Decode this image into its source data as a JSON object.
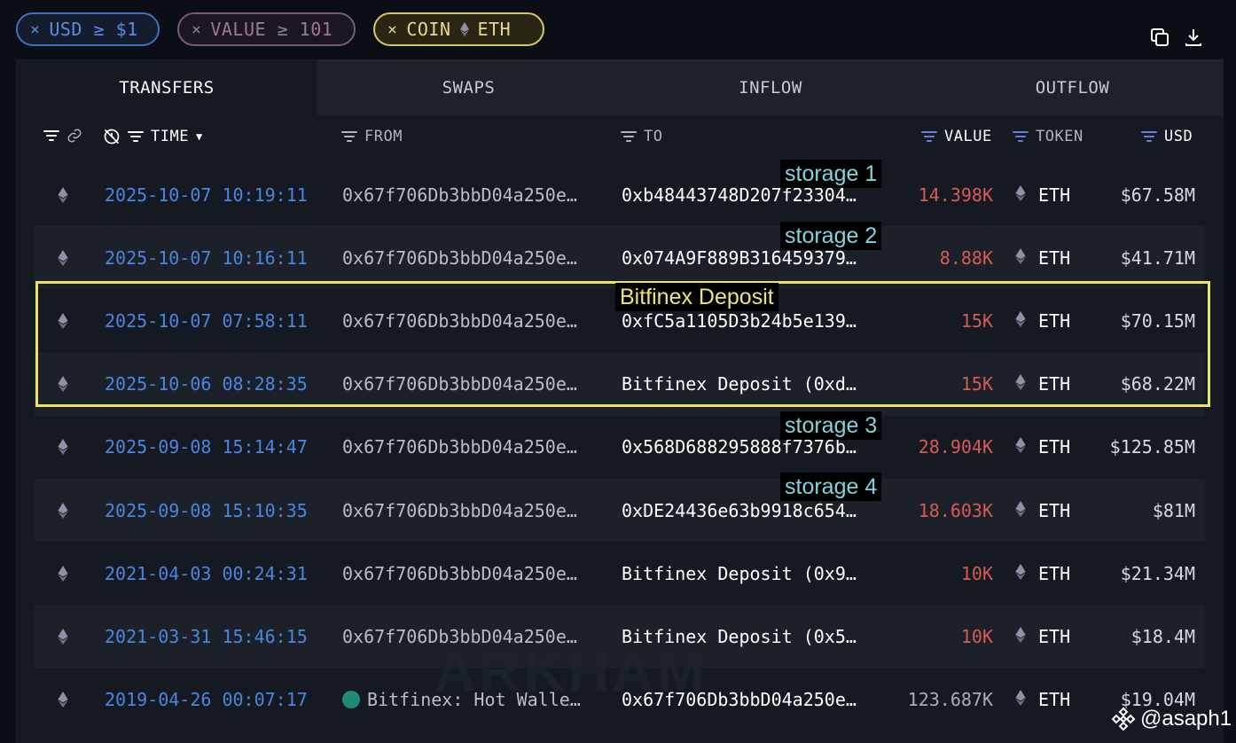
{
  "filters": {
    "usd_chip": "USD ≥ $1",
    "value_chip": "VALUE ≥ 101",
    "coin_chip_prefix": "COIN",
    "coin_chip_value": "ETH",
    "remove_symbol": "×"
  },
  "tabs": [
    "TRANSFERS",
    "SWAPS",
    "INFLOW",
    "OUTFLOW"
  ],
  "columns": {
    "time": "TIME",
    "from": "FROM",
    "to": "TO",
    "value": "VALUE",
    "token": "TOKEN",
    "usd": "USD"
  },
  "rows": [
    {
      "time": "2025-10-07 10:19:11",
      "from": "0x67f706Db3bbD04a250e…",
      "to": "0xb48443748D207f23304…",
      "value": "14.398K",
      "token": "ETH",
      "usd": "$67.58M"
    },
    {
      "time": "2025-10-07 10:16:11",
      "from": "0x67f706Db3bbD04a250e…",
      "to": "0x074A9F889B316459379…",
      "value": "8.88K",
      "token": "ETH",
      "usd": "$41.71M"
    },
    {
      "time": "2025-10-07 07:58:11",
      "from": "0x67f706Db3bbD04a250e…",
      "to": "0xfC5a1105D3b24b5e139…",
      "value": "15K",
      "token": "ETH",
      "usd": "$70.15M"
    },
    {
      "time": "2025-10-06 08:28:35",
      "from": "0x67f706Db3bbD04a250e…",
      "to": "Bitfinex Deposit (0xd…",
      "value": "15K",
      "token": "ETH",
      "usd": "$68.22M"
    },
    {
      "time": "2025-09-08 15:14:47",
      "from": "0x67f706Db3bbD04a250e…",
      "to": "0x568D688295888f7376b…",
      "value": "28.904K",
      "token": "ETH",
      "usd": "$125.85M"
    },
    {
      "time": "2025-09-08 15:10:35",
      "from": "0x67f706Db3bbD04a250e…",
      "to": "0xDE24436e63b9918c654…",
      "value": "18.603K",
      "token": "ETH",
      "usd": "$81M"
    },
    {
      "time": "2021-04-03 00:24:31",
      "from": "0x67f706Db3bbD04a250e…",
      "to": "Bitfinex Deposit (0x9…",
      "value": "10K",
      "token": "ETH",
      "usd": "$21.34M"
    },
    {
      "time": "2021-03-31 15:46:15",
      "from": "0x67f706Db3bbD04a250e…",
      "to": "Bitfinex Deposit (0x5…",
      "value": "10K",
      "token": "ETH",
      "usd": "$18.4M"
    },
    {
      "time": "2019-04-26 00:07:17",
      "from": "Bitfinex: Hot Walle…",
      "to": "0x67f706Db3bbD04a250e…",
      "value": "123.687K",
      "token": "ETH",
      "usd": "$19.04M"
    }
  ],
  "annotations": {
    "storage_1": "storage 1",
    "storage_2": "storage 2",
    "bitfinex_deposit": "Bitfinex Deposit",
    "storage_3": "storage 3",
    "storage_4": "storage 4"
  },
  "watermark": "ARKHAM",
  "attribution": "@asaph1",
  "colors": {
    "time_link": "#4a86e0",
    "value_outflow": "#d85a55",
    "value_inflow": "#a8aeb6",
    "highlight_box": "#ede365",
    "storage_label": "#7fd4e0"
  }
}
